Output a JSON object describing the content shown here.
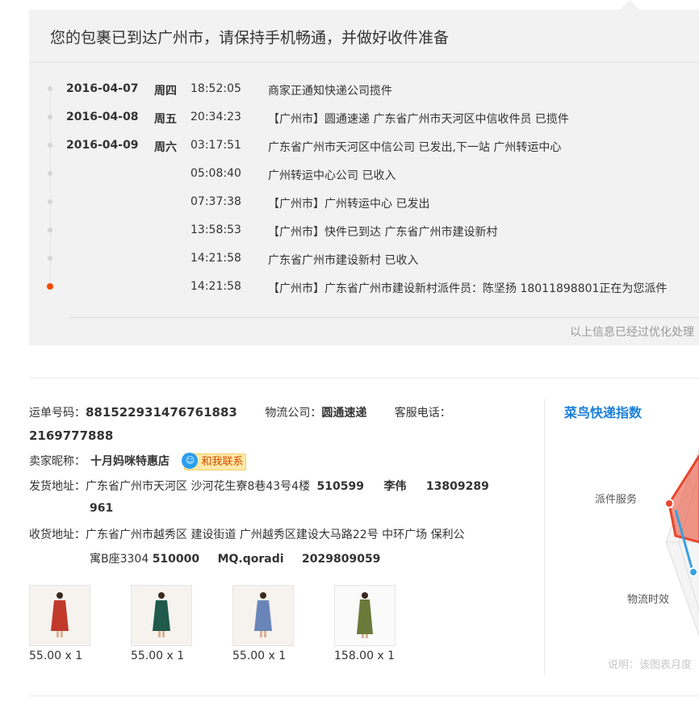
{
  "tracking": {
    "banner": "您的包裹已到达广州市，请保持手机畅通，并做好收件准备",
    "events": [
      {
        "date": "2016-04-07",
        "weekday": "周四",
        "time": "18:52:05",
        "text": "商家正通知快递公司揽件"
      },
      {
        "date": "2016-04-08",
        "weekday": "周五",
        "time": "20:34:23",
        "text": "【广州市】圆通速递 广东省广州市天河区中信收件员 已揽件"
      },
      {
        "date": "2016-04-09",
        "weekday": "周六",
        "time": "03:17:51",
        "text": "广东省广州市天河区中信公司 已发出,下一站 广州转运中心"
      },
      {
        "date": "",
        "weekday": "",
        "time": "05:08:40",
        "text": "广州转运中心公司 已收入"
      },
      {
        "date": "",
        "weekday": "",
        "time": "07:37:38",
        "text": "【广州市】广州转运中心 已发出"
      },
      {
        "date": "",
        "weekday": "",
        "time": "13:58:53",
        "text": "【广州市】快件已到达 广东省广州市建设新村"
      },
      {
        "date": "",
        "weekday": "",
        "time": "14:21:58",
        "text": "广东省广州市建设新村 已收入"
      },
      {
        "date": "",
        "weekday": "",
        "time": "14:21:58",
        "text": "【广州市】广东省广州市建设新村派件员：陈坚扬 18011898801正在为您派件"
      }
    ],
    "note": "以上信息已经过优化处理"
  },
  "order": {
    "waybill_label": "运单号码：",
    "waybill": "881522931476761883",
    "company_label": "物流公司：",
    "company": "圆通速递",
    "phone_label": "客服电话：",
    "phone": "2169777888",
    "seller_label": "卖家昵称：",
    "seller": "十月妈咪特惠店",
    "contact_btn": "和我联系",
    "ship_label": "发货地址：",
    "ship_addr": "广东省广州市天河区 沙河花生寮8巷43号4楼",
    "ship_zip": "510599",
    "ship_name": "李伟",
    "ship_phone_1": "13809289",
    "ship_phone_2": "961",
    "recv_label": "收货地址：",
    "recv_addr_1": "广东省广州市越秀区 建设街道 广州越秀区建设大马路22号 中环广场 保利公",
    "recv_addr_2": "寓B座3304",
    "recv_zip": "510000",
    "recv_name": "MQ.qoradi",
    "recv_phone": "2029809059"
  },
  "products": [
    {
      "price": "55.00 x 1",
      "color": "#c0392b"
    },
    {
      "price": "55.00 x 1",
      "color": "#1f5a4a"
    },
    {
      "price": "55.00 x 1",
      "color": "#6a86b8"
    },
    {
      "price": "158.00 x 1",
      "color": "#6b7a3a"
    }
  ],
  "radar": {
    "logo": "菜鸟快递指数",
    "label_dispatch": "派件服务",
    "label_timeliness": "物流时效",
    "note": "说明：该图表月度",
    "accent": "#e8452c",
    "secondary": "#3aa0e0"
  }
}
